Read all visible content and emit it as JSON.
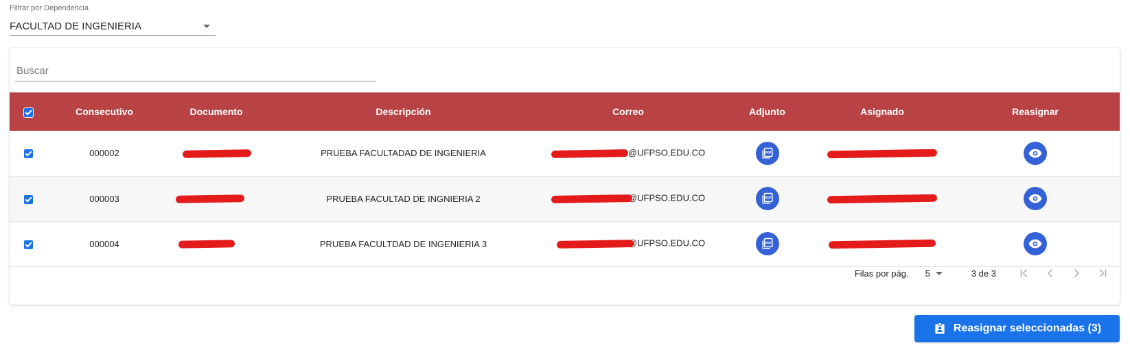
{
  "filter": {
    "label": "Filtrar por Dependencia",
    "value": "FACULTAD DE INGENIERIA"
  },
  "search": {
    "placeholder": "Buscar"
  },
  "table": {
    "columns": [
      "Consecutivo",
      "Documento",
      "Descripción",
      "Correo",
      "Adjunto",
      "Asignado",
      "Reasignar"
    ],
    "rows": [
      {
        "consecutivo": "000002",
        "descripcion": "PRUEBA FACULTADAD DE INGENIERIA",
        "correo_visible": "@UFPSO.EDU.CO",
        "checked": true
      },
      {
        "consecutivo": "000003",
        "descripcion": "PRUEBA FACULTAD DE INGNIERIA 2",
        "correo_visible": "@UFPSO.EDU.CO",
        "checked": true
      },
      {
        "consecutivo": "000004",
        "descripcion": "PRUEBA FACULTDAD DE INGENIERIA 3",
        "correo_visible": "@UFPSO.EDU.CO",
        "checked": true
      }
    ]
  },
  "pagination": {
    "rows_label": "Filas por pág.",
    "rows_value": "5",
    "range": "3 de 3"
  },
  "action": {
    "label": "Reasignar seleccionadas (3)"
  },
  "icons": {
    "attachment": "pdf-file-icon",
    "view": "eye-icon",
    "action": "assignment-ind-icon"
  },
  "colors": {
    "header": "#b84244",
    "primary": "#1a73e8",
    "icon_button": "#3461d6",
    "redaction": "#e41b1b"
  }
}
